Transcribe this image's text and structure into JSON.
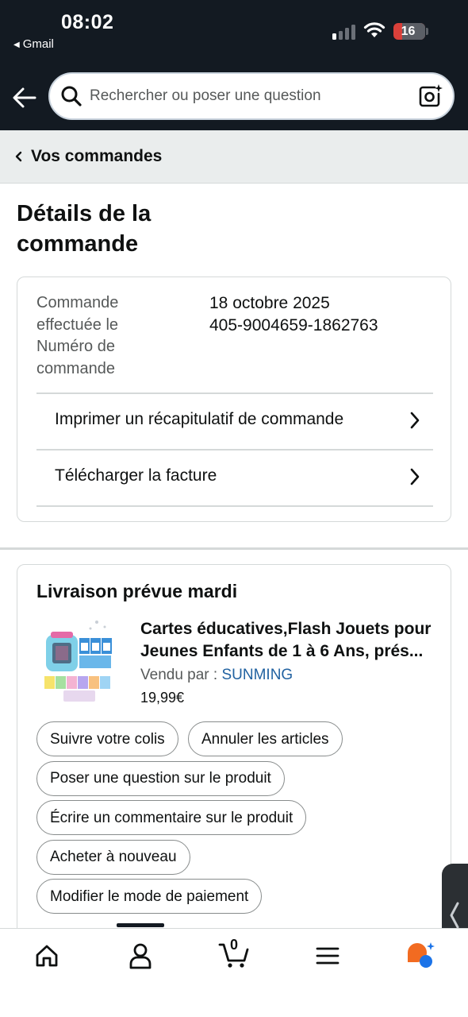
{
  "status_bar": {
    "time": "08:02",
    "back_app": "Gmail",
    "battery": "16"
  },
  "header": {
    "search_placeholder": "Rechercher ou poser une question"
  },
  "breadcrumb": {
    "label": "Vos commandes"
  },
  "page": {
    "title": "Détails de la commande"
  },
  "order": {
    "labels": [
      "Commande effectuée le",
      "Numéro de commande"
    ],
    "date": "18 octobre 2025",
    "number": "405-9004659-1862763",
    "actions": [
      {
        "label": "Imprimer un récapitulatif de commande"
      },
      {
        "label": "Télécharger la facture"
      }
    ]
  },
  "delivery": {
    "title": "Livraison prévue mardi",
    "product": {
      "title": "Cartes éducatives,Flash Jouets pour Jeunes Enfants de 1 à 6 Ans, prés...",
      "seller_label": "Vendu par  : ",
      "seller": "SUNMING",
      "price": "19,99€"
    },
    "buttons": [
      {
        "label": "Suivre votre colis"
      },
      {
        "label": "Annuler les articles"
      },
      {
        "label": "Poser une question sur le produit"
      },
      {
        "label": "Écrire un commentaire sur le produit"
      },
      {
        "label": "Acheter à nouveau"
      },
      {
        "label": "Modifier le mode de paiement"
      }
    ]
  },
  "tabbar": {
    "cart_count": "0",
    "tabs": [
      "home-icon",
      "account-icon",
      "cart-icon",
      "menu-icon",
      "rufus-ai-icon"
    ]
  },
  "colors": {
    "header_bg": "#131a22",
    "link": "#2162a1",
    "battery_low": "#d9403a"
  }
}
